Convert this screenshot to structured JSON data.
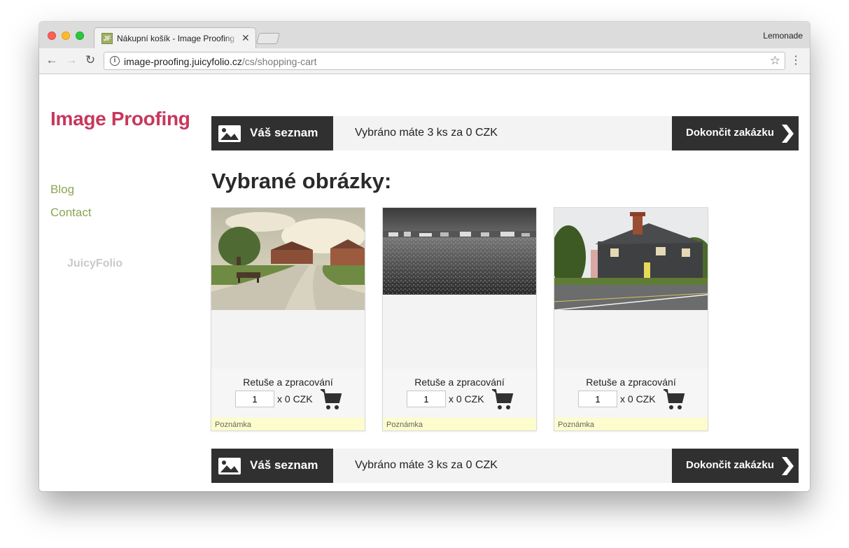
{
  "browser": {
    "tab_title": "Nákupní košík - Image Proofing",
    "favicon_text": "JF",
    "profile_name": "Lemonade",
    "url_host": "image-proofing.juicyfolio.cz",
    "url_path": "/cs/shopping-cart"
  },
  "sidebar": {
    "logo": "Image Proofing",
    "links": [
      {
        "label": "Blog"
      },
      {
        "label": "Contact"
      }
    ],
    "brand": "JuicyFolio"
  },
  "top_bar": {
    "list_label": "Váš seznam",
    "summary": "Vybráno máte 3 ks za 0 CZK",
    "finish_label": "Dokončit zakázku"
  },
  "bottom_bar": {
    "list_label": "Váš seznam",
    "summary": "Vybráno máte 3 ks za 0 CZK",
    "finish_label": "Dokončit zakázku"
  },
  "main": {
    "heading": "Vybrané obrázky:",
    "items": [
      {
        "option": "Retuše a zpracování",
        "quantity": "1",
        "price": "x 0 CZK",
        "note": "Poznámka"
      },
      {
        "option": "Retuše a zpracování",
        "quantity": "1",
        "price": "x 0 CZK",
        "note": "Poznámka"
      },
      {
        "option": "Retuše a zpracování",
        "quantity": "1",
        "price": "x 0 CZK",
        "note": "Poznámka"
      }
    ]
  },
  "colors": {
    "logo": "#c8375c",
    "sidebar_link": "#8aa652",
    "dark_button": "#303030",
    "note_bg": "#fdfccc"
  }
}
